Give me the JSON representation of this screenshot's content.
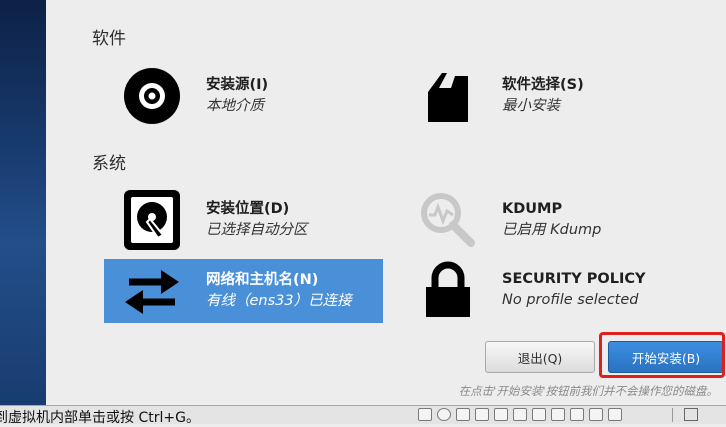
{
  "sections": {
    "software_title": "软件",
    "system_title": "系统"
  },
  "spokes": {
    "install_source": {
      "title": "安装源(I)",
      "status": "本地介质",
      "icon": "disc-icon"
    },
    "software_selection": {
      "title": "软件选择(S)",
      "status": "最小安装",
      "icon": "package-icon"
    },
    "install_destination": {
      "title": "安装位置(D)",
      "status": "已选择自动分区",
      "icon": "harddisk-icon"
    },
    "kdump": {
      "title": "KDUMP",
      "status": "已启用 Kdump",
      "icon": "magnifier-icon"
    },
    "network": {
      "title": "网络和主机名(N)",
      "status": "有线（ens33）已连接",
      "icon": "network-arrows-icon"
    },
    "security": {
      "title": "SECURITY POLICY",
      "status": "No profile selected",
      "icon": "lock-icon"
    }
  },
  "buttons": {
    "quit": "退出(Q)",
    "begin": "开始安装(B)"
  },
  "hint": "在点击'开始安装'按钮前我们并不会操作您的磁盘。",
  "vm_status": {
    "message": "到虚拟机内部单击或按 Ctrl+G。"
  },
  "colors": {
    "selected_spoke": "#4a90d9",
    "begin_button": "#2a72c2",
    "highlight_frame": "#e0201c",
    "sidebar": "#173a6d"
  }
}
